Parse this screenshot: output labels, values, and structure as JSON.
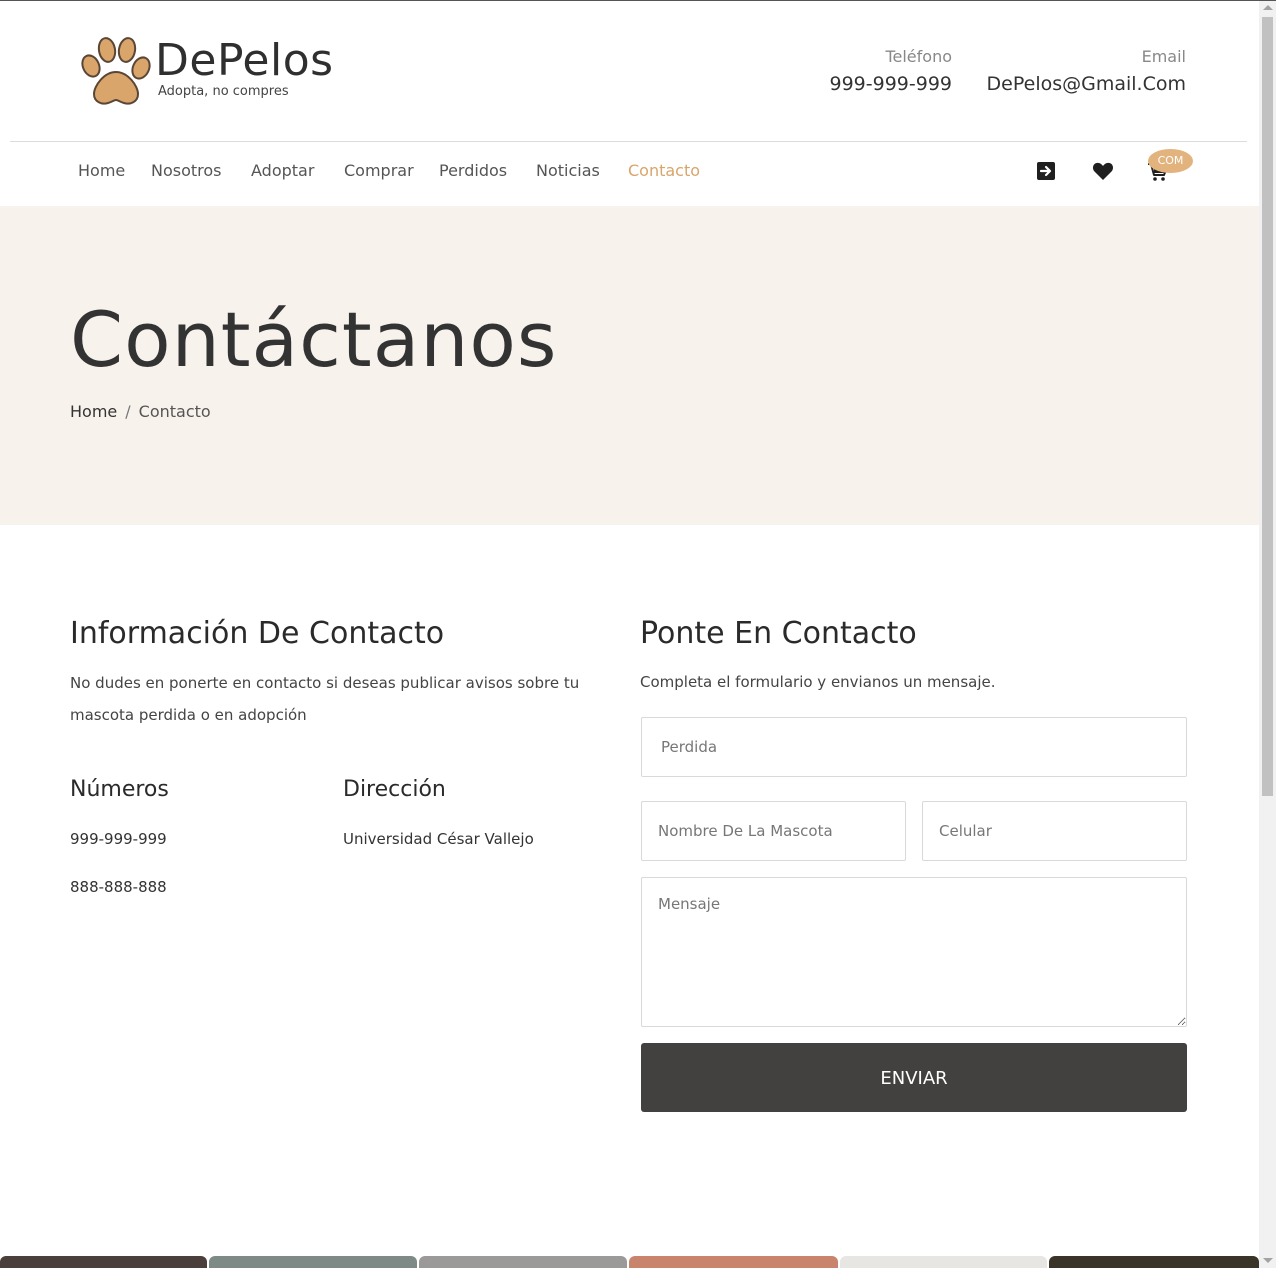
{
  "brand": {
    "name": "DePelos",
    "tagline": "Adopta, no compres",
    "accent_color": "#d8a56b",
    "paw_color": "#d9a56b"
  },
  "header": {
    "phone_label": "Teléfono",
    "phone_value": "999-999-999",
    "email_label": "Email",
    "email_value": "DePelos@Gmail.Com"
  },
  "nav": {
    "items": [
      {
        "label": "Home"
      },
      {
        "label": "Nosotros"
      },
      {
        "label": "Adoptar"
      },
      {
        "label": "Comprar"
      },
      {
        "label": "Perdidos"
      },
      {
        "label": "Noticias"
      },
      {
        "label": "Contacto",
        "active": true
      }
    ],
    "icons": [
      "login-icon",
      "heart-icon",
      "cart-icon"
    ],
    "cart_badge": "COM"
  },
  "hero": {
    "title": "Contáctanos",
    "breadcrumb_home": "Home",
    "breadcrumb_sep": "/",
    "breadcrumb_current": "Contacto",
    "background": "#f8f2ec"
  },
  "info": {
    "title": "Información De Contacto",
    "description": "No dudes en ponerte en contacto si deseas publicar avisos sobre tu mascota perdida o en adopción",
    "numbers_title": "Números",
    "numbers": [
      "999-999-999",
      "888-888-888"
    ],
    "address_title": "Dirección",
    "address": "Universidad César Vallejo"
  },
  "form": {
    "title": "Ponte En Contacto",
    "subtitle": "Completa el formulario y envianos un mensaje.",
    "subject_placeholder": "Perdida",
    "pet_name_placeholder": "Nombre De La Mascota",
    "phone_placeholder": "Celular",
    "message_placeholder": "Mensaje",
    "submit_label": "ENVIAR",
    "button_color": "#424140"
  }
}
